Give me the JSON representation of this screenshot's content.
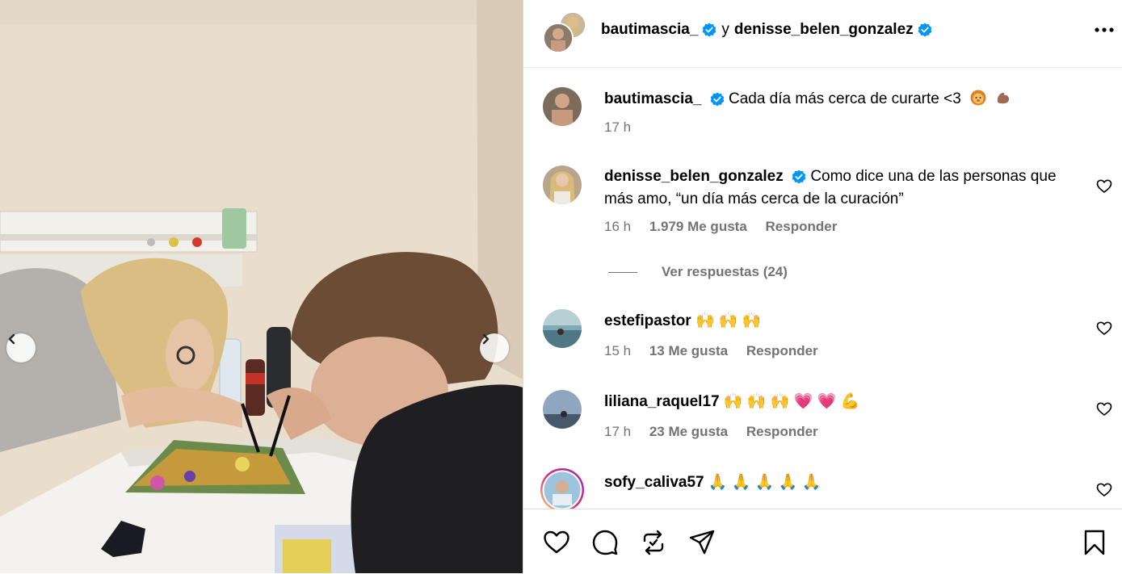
{
  "header": {
    "user1": "bautimascia_",
    "separator": "y",
    "user2": "denisse_belen_gonzalez",
    "more_icon": "more-horizontal-icon"
  },
  "caption": {
    "username": "bautimascia_",
    "text": "Cada día más cerca de curarte <3",
    "emojis": [
      "lion-face-emoji",
      "flexed-biceps-emoji"
    ],
    "time": "17 h"
  },
  "comments": [
    {
      "username": "denisse_belen_gonzalez",
      "verified": true,
      "text": "Como dice una de las personas que más amo, “un día más cerca de la curación”",
      "time": "16 h",
      "likes": "1.979 Me gusta",
      "reply": "Responder",
      "view_replies": "Ver respuestas (24)"
    },
    {
      "username": "estefipastor",
      "text": "🙌 🙌 🙌",
      "time": "15 h",
      "likes": "13 Me gusta",
      "reply": "Responder"
    },
    {
      "username": "liliana_raquel17",
      "text": "🙌 🙌 🙌 💗 💗 💪",
      "time": "17 h",
      "likes": "23 Me gusta",
      "reply": "Responder"
    },
    {
      "username": "sofy_caliva57",
      "text": "🙏 🙏 🙏 🙏 🙏",
      "time": "",
      "likes": "",
      "reply": ""
    }
  ],
  "actions": [
    "heart-icon",
    "comment-icon",
    "repost-icon",
    "share-icon",
    "bookmark-icon"
  ],
  "colors": {
    "verified": "#0095f6",
    "muted": "#737373",
    "divider": "#dbdbdb"
  }
}
